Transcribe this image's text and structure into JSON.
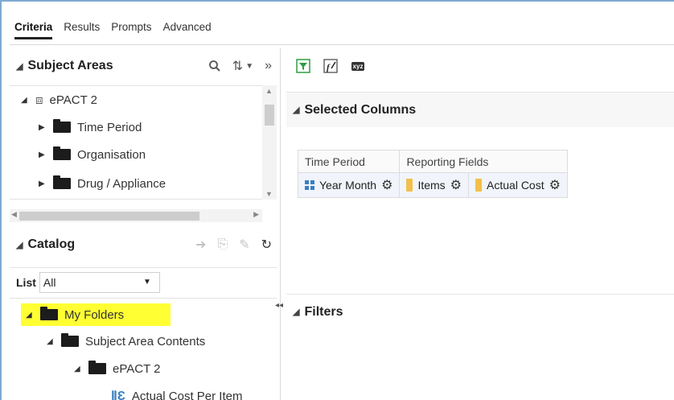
{
  "tabs": [
    {
      "label": "Criteria",
      "active": true
    },
    {
      "label": "Results",
      "active": false
    },
    {
      "label": "Prompts",
      "active": false
    },
    {
      "label": "Advanced",
      "active": false
    }
  ],
  "subject_areas": {
    "title": "Subject Areas",
    "tools": [
      "search-icon",
      "sort-icon",
      "expand-panel-icon"
    ],
    "tree": [
      {
        "label": "ePACT 2",
        "icon": "subject-area-icon",
        "expanded": true
      },
      {
        "label": "Time Period",
        "icon": "folder-icon"
      },
      {
        "label": "Organisation",
        "icon": "folder-icon"
      },
      {
        "label": "Drug / Appliance",
        "icon": "folder-icon"
      }
    ]
  },
  "catalog": {
    "title": "Catalog",
    "list_label": "List",
    "list_value": "All",
    "tree": [
      {
        "label": "My Folders",
        "highlight": true
      },
      {
        "label": "Subject Area Contents"
      },
      {
        "label": "ePACT 2"
      },
      {
        "label": "Actual Cost Per Item"
      }
    ]
  },
  "criteria": {
    "toolbar": [
      "filter-icon",
      "edit-formula-icon",
      "xyz-icon"
    ],
    "xyz_text": "xyz",
    "selected_columns_title": "Selected Columns",
    "filters_title": "Filters",
    "groups": [
      {
        "title": "Time Period",
        "columns": [
          {
            "label": "Year Month",
            "icon": "hierarchy-icon"
          }
        ]
      },
      {
        "title": "Reporting Fields",
        "columns": [
          {
            "label": "Items",
            "icon": "measure-icon"
          },
          {
            "label": "Actual Cost",
            "icon": "measure-icon"
          }
        ]
      }
    ]
  },
  "colors": {
    "highlight": "#ffff33",
    "accent": "#3a7fc1",
    "measure": "#f2c04a",
    "filter_green": "#2f9e41"
  }
}
